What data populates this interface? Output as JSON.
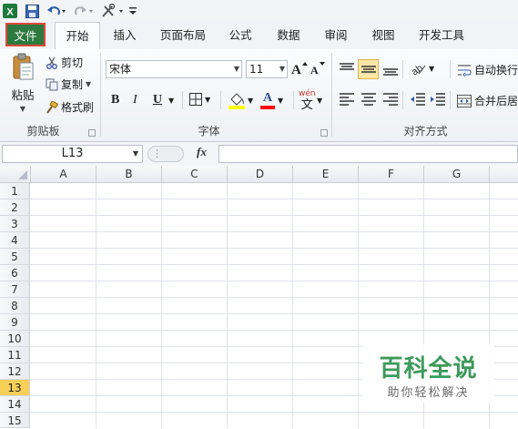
{
  "quick_access": {
    "icons": [
      "excel-logo-icon",
      "save-icon",
      "undo-icon",
      "redo-icon",
      "tools-icon",
      "customize-icon"
    ]
  },
  "tabs": [
    "文件",
    "开始",
    "插入",
    "页面布局",
    "公式",
    "数据",
    "审阅",
    "视图",
    "开发工具"
  ],
  "ribbon": {
    "clipboard": {
      "paste_label": "粘贴",
      "cut_label": "剪切",
      "copy_label": "复制",
      "format_painter_label": "格式刷",
      "group_label": "剪贴板"
    },
    "font": {
      "font_name": "宋体",
      "font_size": "11",
      "bold": "B",
      "italic": "I",
      "underline": "U",
      "group_label": "字体",
      "phonetic_glyph": "wén",
      "phonetic_char": "文",
      "font_color_glyph": "A"
    },
    "alignment": {
      "wrap_text_label": "自动换行",
      "merge_label": "合并后居",
      "group_label": "对齐方式"
    }
  },
  "formula_bar": {
    "name_box": "L13",
    "fx_label": "fx"
  },
  "grid": {
    "columns": [
      "A",
      "B",
      "C",
      "D",
      "E",
      "F",
      "G"
    ],
    "rows": [
      "1",
      "2",
      "3",
      "4",
      "5",
      "6",
      "7",
      "8",
      "9",
      "10",
      "11",
      "12",
      "13",
      "14",
      "15"
    ],
    "active_row": "13"
  },
  "watermark": {
    "title": "百科全说",
    "subtitle": "助你轻松解决"
  },
  "colors": {
    "file_tab": "#2d7a3f",
    "highlight_border": "#e0463c",
    "active_row_header": "#f8cf58",
    "watermark_green": "#3c9a5a"
  }
}
